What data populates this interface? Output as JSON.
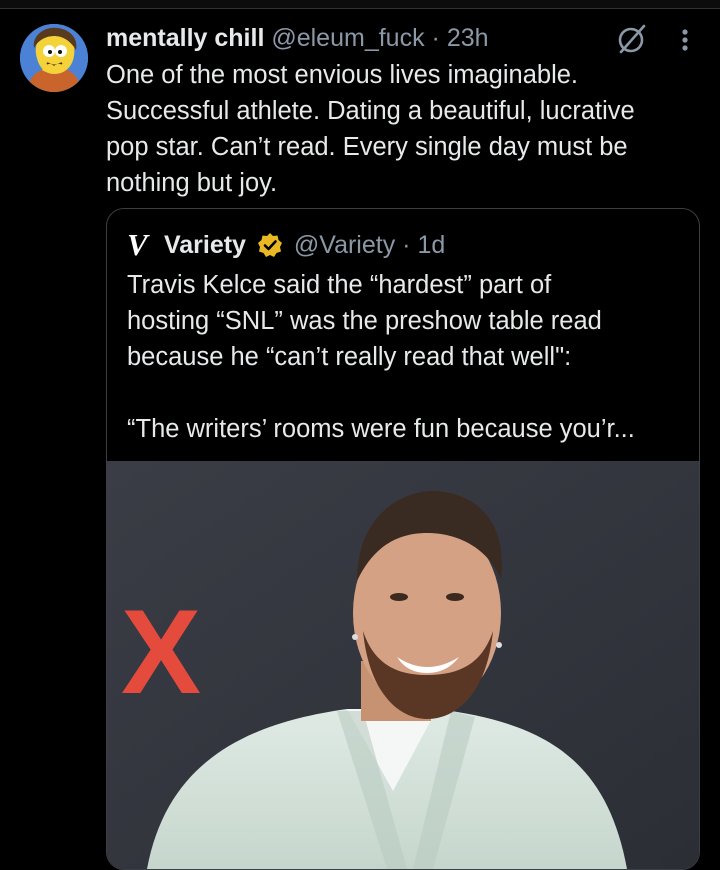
{
  "tweet": {
    "display_name": "mentally chill",
    "handle": "@eleum_fuck",
    "separator": "·",
    "time": "23h",
    "text": "One of the most envious lives imaginable.\nSuccessful athlete. Dating a beautiful, lucrative\npop star. Can’t read. Every single day must be\nnothing but joy.",
    "avatar_icon": "cartoon-avatar",
    "action_icons": [
      "grok-icon",
      "more-icon"
    ]
  },
  "quote": {
    "logo_letter": "V",
    "display_name": "Variety",
    "verified_badge": "gold-verified-icon",
    "handle": "@Variety",
    "separator": "·",
    "time": "1d",
    "text": "Travis Kelce said the “hardest” part of\nhosting “SNL” was the preshow table read\nbecause he “can’t really read that well\":\n\n“The writers’ rooms were fun because you’r...",
    "photo_backdrop_letter": "X"
  },
  "colors": {
    "background": "#000000",
    "text_primary": "#e7e9ea",
    "text_secondary": "#8b98a5",
    "border": "#3a3f44",
    "verified_gold": "#e8b923",
    "backdrop_red": "#e54b3c"
  }
}
